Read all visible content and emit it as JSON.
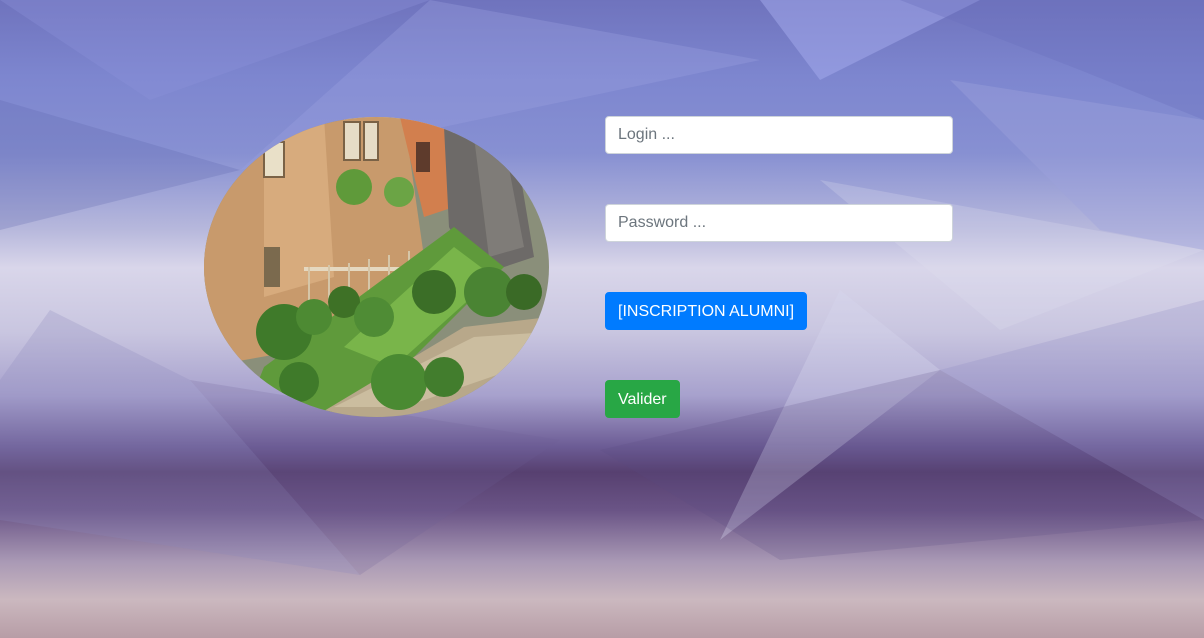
{
  "login": {
    "login_placeholder": "Login ...",
    "password_placeholder": "Password ...",
    "inscription_label": "[INSCRIPTION ALUMNI]",
    "valider_label": "Valider"
  },
  "colors": {
    "primary": "#007bff",
    "success": "#28a745",
    "background_top": "#7d86cf",
    "background_band": "#574070"
  }
}
